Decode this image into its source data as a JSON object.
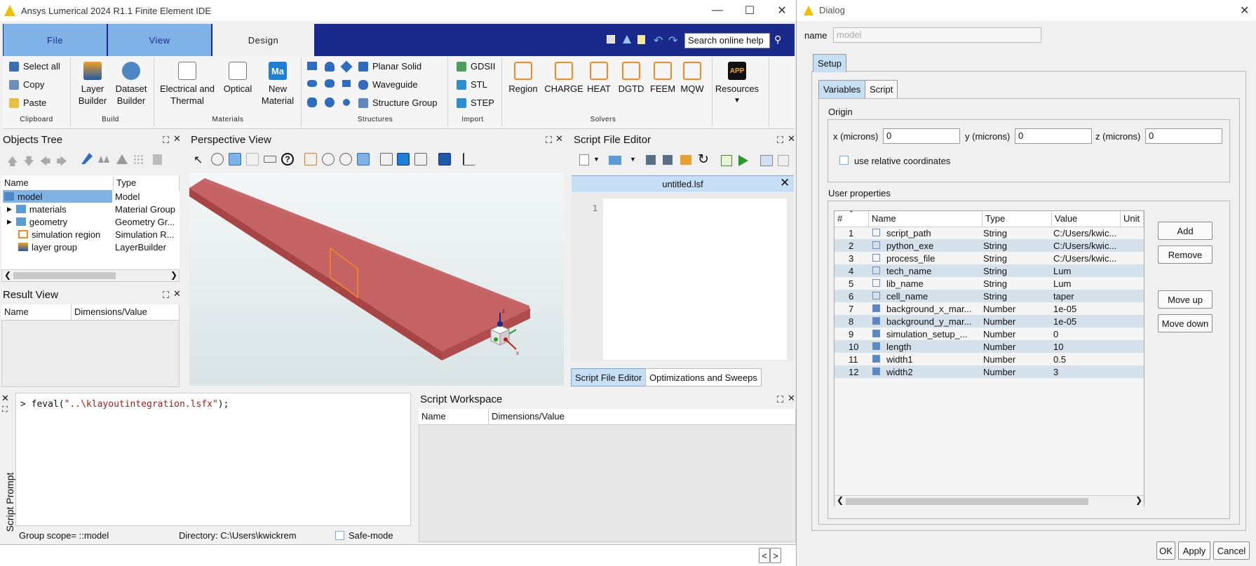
{
  "app": {
    "title": "Ansys Lumerical 2024 R1.1 Finite Element IDE",
    "ribbon_tabs": [
      "File",
      "View",
      "Design"
    ],
    "search_placeholder": "Search online help"
  },
  "ribbon": {
    "clipboard": {
      "label": "Clipboard",
      "select_all": "Select all",
      "copy": "Copy",
      "paste": "Paste"
    },
    "build": {
      "label": "Build",
      "layer_builder": "Layer Builder",
      "dataset_builder": "Dataset Builder"
    },
    "materials": {
      "label": "Materials",
      "electrical": "Electrical and Thermal",
      "optical": "Optical",
      "new_material": "New Material",
      "new_material_icon_text": "Ma"
    },
    "structures": {
      "label": "Structures",
      "planar_solid": "Planar Solid",
      "waveguide": "Waveguide",
      "structure_group": "Structure Group"
    },
    "import": {
      "label": "Import",
      "gdsii": "GDSII",
      "stl": "STL",
      "step": "STEP"
    },
    "solvers": {
      "label": "Solvers",
      "items": [
        "Region",
        "CHARGE",
        "HEAT",
        "DGTD",
        "FEEM",
        "MQW"
      ]
    },
    "resources": {
      "label": "Resources",
      "icon_text": "APP"
    }
  },
  "objects_tree": {
    "title": "Objects Tree",
    "columns": [
      "Name",
      "Type"
    ],
    "rows": [
      {
        "name": "model",
        "type": "Model"
      },
      {
        "name": "materials",
        "type": "Material Group"
      },
      {
        "name": "geometry",
        "type": "Geometry Gr..."
      },
      {
        "name": "simulation region",
        "type": "Simulation R..."
      },
      {
        "name": "layer group",
        "type": "LayerBuilder"
      }
    ]
  },
  "result_view": {
    "title": "Result View",
    "columns": [
      "Name",
      "Dimensions/Value"
    ]
  },
  "perspective": {
    "title": "Perspective View",
    "axis_z": "z",
    "axis_x": "x"
  },
  "script_editor": {
    "title": "Script File Editor",
    "file": "untitled.lsf",
    "line": "1",
    "tabs": [
      "Script File Editor",
      "Optimizations and Sweeps"
    ]
  },
  "script_prompt": {
    "label": "Script Prompt",
    "command_prefix": "> feval(",
    "command_string": "\"..\\klayoutintegration.lsfx\"",
    "command_suffix": ");",
    "group_scope": "Group scope= ::model",
    "directory": "Directory: C:\\Users\\kwickrem",
    "safe_mode": "Safe-mode"
  },
  "workspace": {
    "title": "Script Workspace",
    "columns": [
      "Name",
      "Dimensions/Value"
    ]
  },
  "nav": {
    "prev": "<",
    "next": ">"
  },
  "dialog": {
    "title": "Dialog",
    "name_label": "name",
    "name_value": "model",
    "outer_tab": "Setup",
    "tabs": [
      "Variables",
      "Script"
    ],
    "origin_label": "Origin",
    "x_label": "x (microns)",
    "x_value": "0",
    "y_label": "y (microns)",
    "y_value": "0",
    "z_label": "z (microns)",
    "z_value": "0",
    "relative_label": "use relative coordinates",
    "user_props_label": "User properties",
    "columns": [
      "#",
      "Name",
      "Type",
      "Value",
      "Unit"
    ],
    "rows": [
      {
        "n": "1",
        "name": "script_path",
        "type": "String",
        "value": "C:/Users/kwic..."
      },
      {
        "n": "2",
        "name": "python_exe",
        "type": "String",
        "value": "C:/Users/kwic..."
      },
      {
        "n": "3",
        "name": "process_file",
        "type": "String",
        "value": "C:/Users/kwic..."
      },
      {
        "n": "4",
        "name": "tech_name",
        "type": "String",
        "value": "Lum"
      },
      {
        "n": "5",
        "name": "lib_name",
        "type": "String",
        "value": "Lum"
      },
      {
        "n": "6",
        "name": "cell_name",
        "type": "String",
        "value": "taper"
      },
      {
        "n": "7",
        "name": "background_x_mar...",
        "type": "Number",
        "value": "1e-05"
      },
      {
        "n": "8",
        "name": "background_y_mar...",
        "type": "Number",
        "value": "1e-05"
      },
      {
        "n": "9",
        "name": "simulation_setup_...",
        "type": "Number",
        "value": "0"
      },
      {
        "n": "10",
        "name": "length",
        "type": "Number",
        "value": "10"
      },
      {
        "n": "11",
        "name": "width1",
        "type": "Number",
        "value": "0.5"
      },
      {
        "n": "12",
        "name": "width2",
        "type": "Number",
        "value": "3"
      }
    ],
    "buttons": {
      "add": "Add",
      "remove": "Remove",
      "move_up": "Move up",
      "move_down": "Move down",
      "ok": "OK",
      "apply": "Apply",
      "cancel": "Cancel"
    }
  }
}
